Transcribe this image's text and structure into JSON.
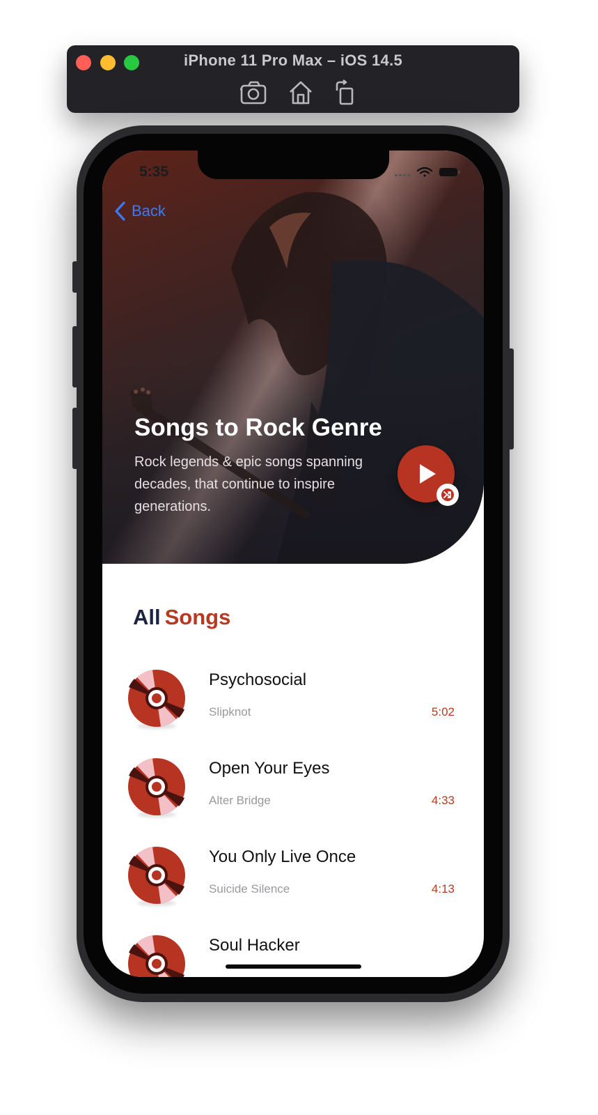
{
  "simulator": {
    "title": "iPhone 11 Pro Max – iOS 14.5",
    "toolbar": [
      "screenshot-icon",
      "home-icon",
      "rotate-icon"
    ]
  },
  "status_bar": {
    "time": "5:35"
  },
  "nav": {
    "back_label": "Back"
  },
  "hero": {
    "title": "Songs to Rock Genre",
    "description": "Rock legends & epic songs spanning decades, that continue to inspire generations.",
    "play_icon": "play-icon",
    "shuffle_icon": "shuffle-icon"
  },
  "songs_section": {
    "title_part1": "All",
    "title_part2": "Songs"
  },
  "songs": [
    {
      "title": "Psychosocial",
      "artist": "Slipknot",
      "duration": "5:02"
    },
    {
      "title": "Open Your Eyes",
      "artist": "Alter Bridge",
      "duration": "4:33"
    },
    {
      "title": "You Only Live Once",
      "artist": "Suicide Silence",
      "duration": "4:13"
    },
    {
      "title": "Soul Hacker",
      "artist": "",
      "duration": ""
    }
  ],
  "colors": {
    "accent": "#b63421",
    "section_dark": "#1b2340",
    "link": "#3a7bfd",
    "muted": "#9a9a9e"
  }
}
